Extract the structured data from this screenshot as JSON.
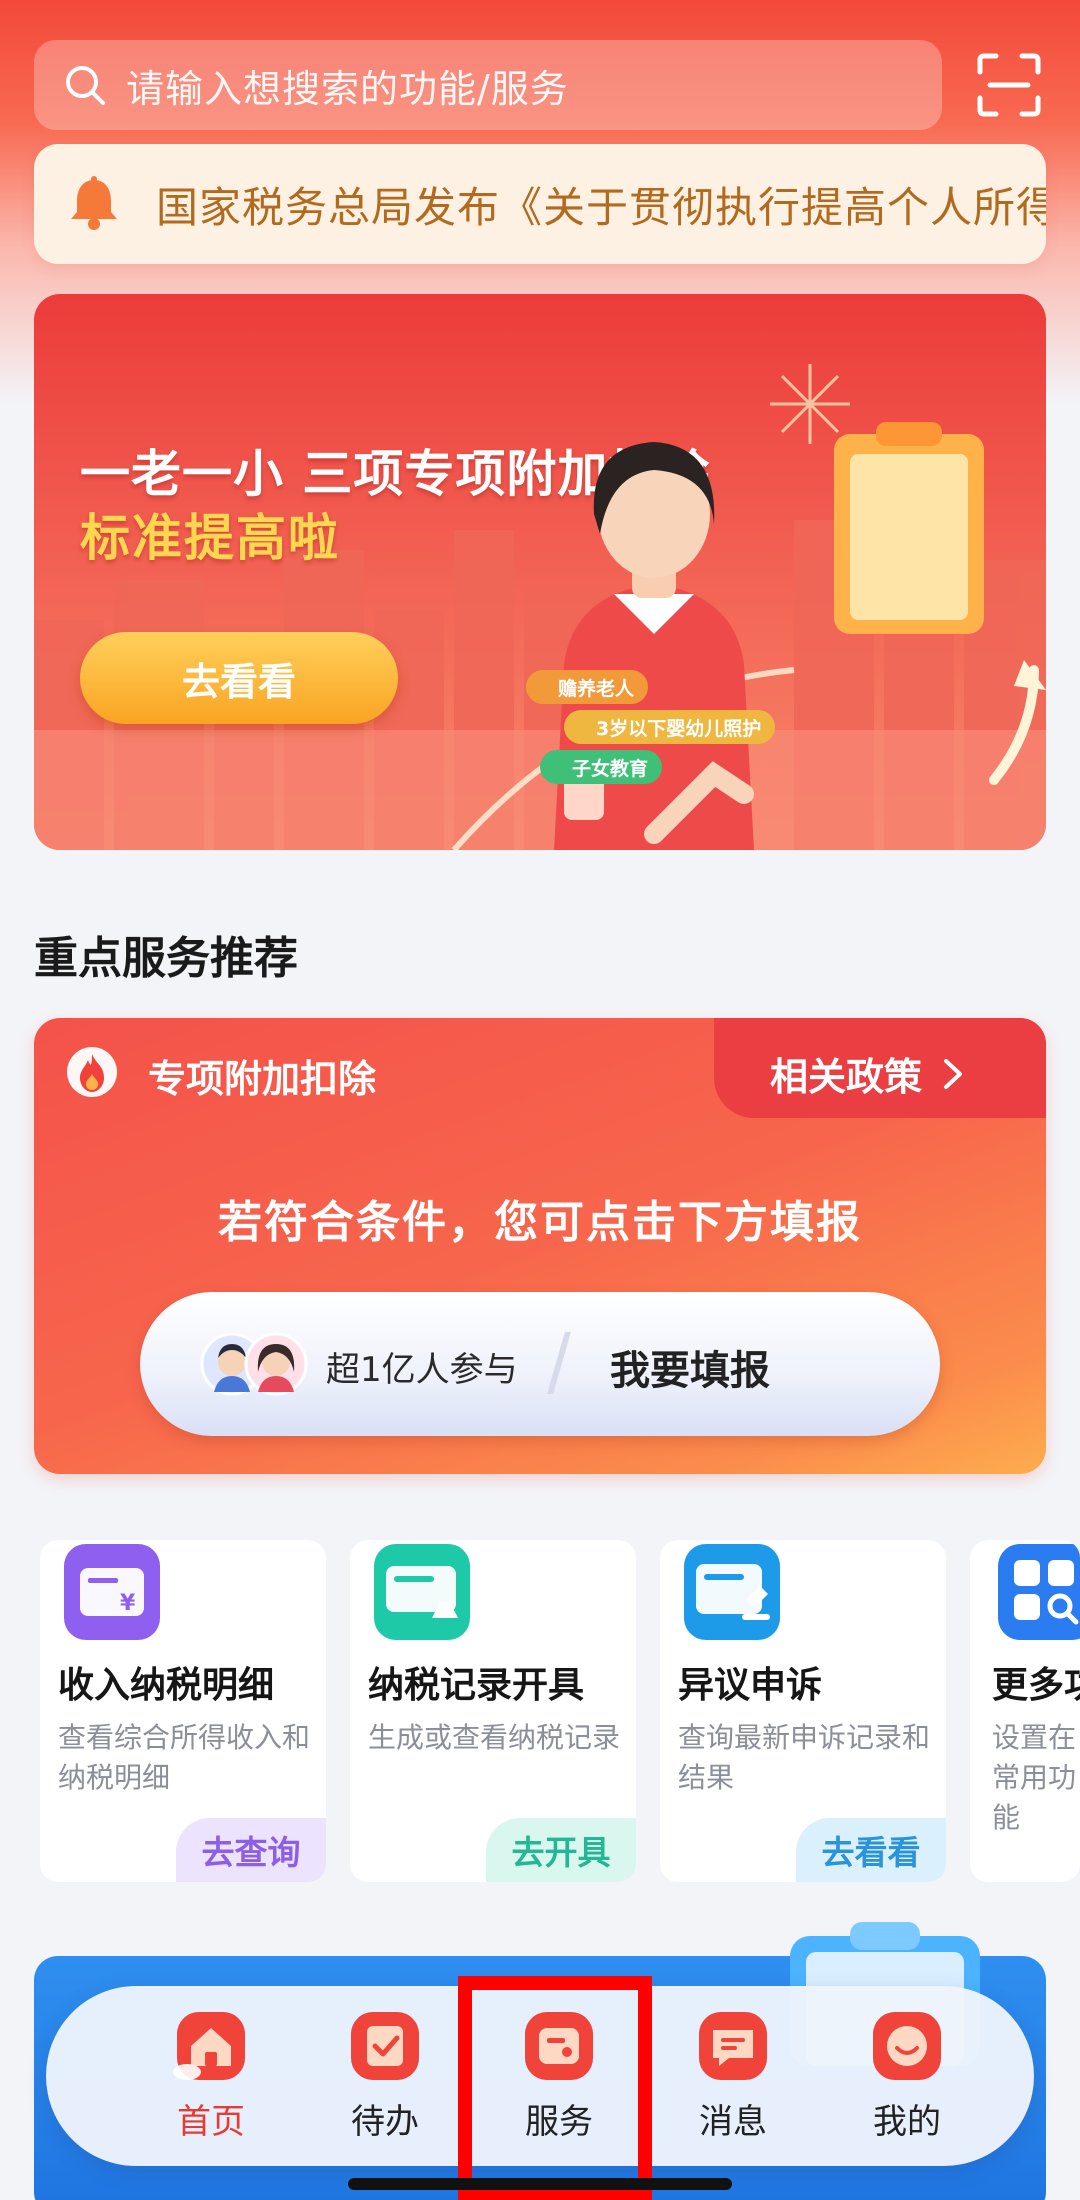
{
  "search": {
    "placeholder": "请输入想搜索的功能/服务"
  },
  "notice": {
    "text": "国家税务总局发布《关于贯彻执行提高个人所得税有关专项附加扣除标准的通知》"
  },
  "banner": {
    "title_line1": "一老一小 三项专项附加扣除",
    "title_line2": "标准提高啦",
    "button_label": "去看看",
    "chips": [
      "赡养老人",
      "3岁以下婴幼儿照护",
      "子女教育"
    ]
  },
  "section": {
    "title": "重点服务推荐"
  },
  "deduction": {
    "title": "专项附加扣除",
    "policy_link": "相关政策",
    "message": "若符合条件，您可点击下方填报",
    "participants": "超1亿人参与",
    "fill_button": "我要填报"
  },
  "services": [
    {
      "name": "收入纳税明细",
      "desc": "查看综合所得收入和纳税明细",
      "action": "去查询"
    },
    {
      "name": "纳税记录开具",
      "desc": "生成或查看纳税记录",
      "action": "去开具"
    },
    {
      "name": "异议申诉",
      "desc": "查询最新申诉记录和结果",
      "action": "去看看"
    },
    {
      "name": "更多功能",
      "desc": "设置在常用功能",
      "action": ""
    }
  ],
  "tabbar": {
    "items": [
      {
        "label": "首页",
        "active": true
      },
      {
        "label": "待办",
        "active": false
      },
      {
        "label": "服务",
        "active": false
      },
      {
        "label": "消息",
        "active": false
      },
      {
        "label": "我的",
        "active": false
      }
    ]
  },
  "colors": {
    "brand_red": "#f3493a",
    "active_tab": "#e63b32",
    "highlight_box": "#ff0000",
    "notice_text": "#b26a1e"
  }
}
